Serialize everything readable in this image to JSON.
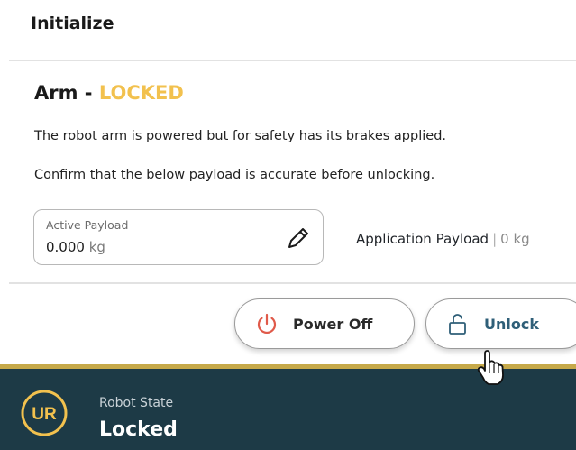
{
  "header": {
    "title": "Initialize"
  },
  "arm": {
    "heading": "Arm - ",
    "status": "LOCKED",
    "description": "The robot arm is powered but for safety has its brakes applied.",
    "instruction": "Confirm that the below payload is accurate before unlocking."
  },
  "payload": {
    "label": "Active Payload",
    "value": "0.000",
    "unit": "kg",
    "edit_icon": "pencil-icon"
  },
  "application_payload": {
    "label": "Application Payload",
    "separator": "|",
    "value": "0 kg"
  },
  "buttons": {
    "power_off": {
      "label": "Power Off",
      "icon": "power-icon"
    },
    "unlock": {
      "label": "Unlock",
      "icon": "unlock-icon"
    }
  },
  "footer": {
    "state_label": "Robot State",
    "state_value": "Locked",
    "logo_text": "UR"
  },
  "colors": {
    "locked_status": "#f2c14e",
    "footer_bg": "#1d3a46",
    "footer_accent": "#c6a94a",
    "power_icon": "#e05a4a",
    "unlock_accent": "#2f5f78"
  }
}
